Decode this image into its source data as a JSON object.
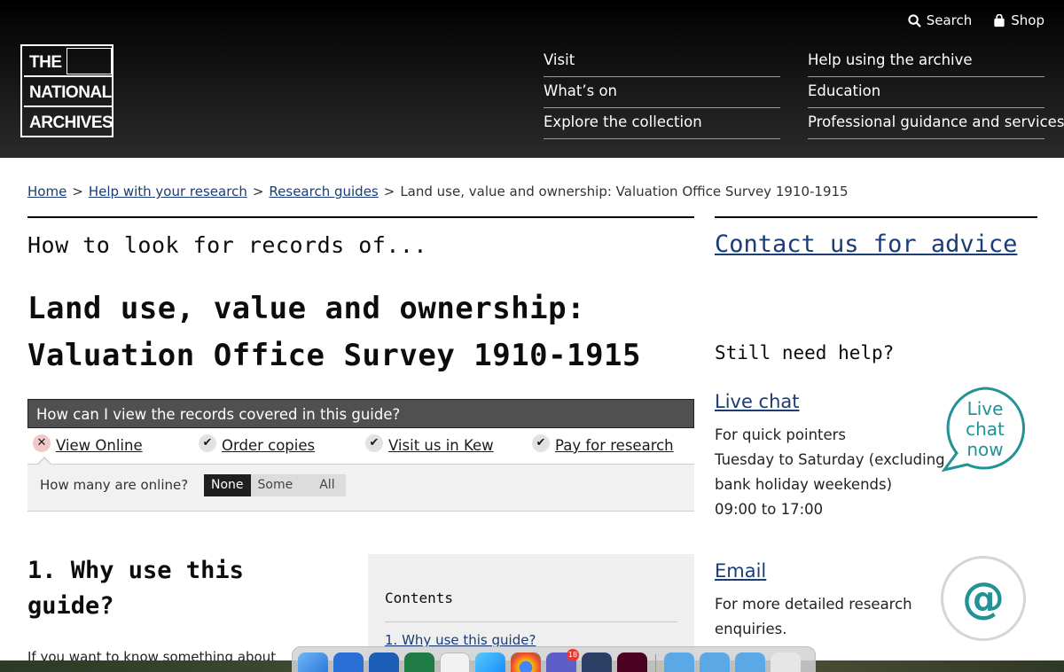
{
  "header": {
    "util": {
      "search": "Search",
      "shop": "Shop"
    },
    "logo": {
      "line1": "THE",
      "line2": "NATIONAL",
      "line3": "ARCHIVES"
    },
    "nav_col1": [
      "Visit",
      "What’s on",
      "Explore the collection"
    ],
    "nav_col2": [
      "Help using the archive",
      "Education",
      "Professional guidance and services"
    ]
  },
  "breadcrumb": {
    "items": [
      "Home",
      "Help with your research",
      "Research guides"
    ],
    "current": "Land use, value and ownership: Valuation Office Survey 1910-1915",
    "separator": ">"
  },
  "main": {
    "kicker": "How to look for records of...",
    "title_line1": "Land use, value and ownership:",
    "title_line2": "Valuation Office Survey 1910-1915",
    "view_question": "How can I view the records covered in this guide?",
    "options": [
      {
        "label": "View Online",
        "icon": "cross-icon"
      },
      {
        "label": "Order copies",
        "icon": "check-icon"
      },
      {
        "label": "Visit us in Kew",
        "icon": "check-icon"
      },
      {
        "label": "Pay for research",
        "icon": "check-icon"
      }
    ],
    "online_question": "How many are online?",
    "online_choices": [
      "None",
      "Some",
      "All"
    ],
    "online_selected": "None",
    "section1_heading": "1. Why use this guide?",
    "section1_para": "If you want to know something about"
  },
  "contents": {
    "title": "Contents",
    "first_item": "1. Why use this guide?"
  },
  "sidebar": {
    "contact": "Contact us for advice",
    "still": "Still need help?",
    "chat_link": "Live chat",
    "chat_text": [
      "For quick pointers",
      "Tuesday to Saturday (excluding bank holiday weekends)",
      "09:00 to 17:00"
    ],
    "chat_bubble": [
      "Live",
      "chat",
      "now"
    ],
    "email_link": "Email",
    "email_text": "For more detailed research enquiries.",
    "email_icon_glyph": "@"
  },
  "dock": {
    "teams_badge": "18"
  },
  "colors": {
    "header_bg": "#000000",
    "link": "#1a3c78",
    "accent_teal": "#239296",
    "view_bar": "#505050"
  }
}
